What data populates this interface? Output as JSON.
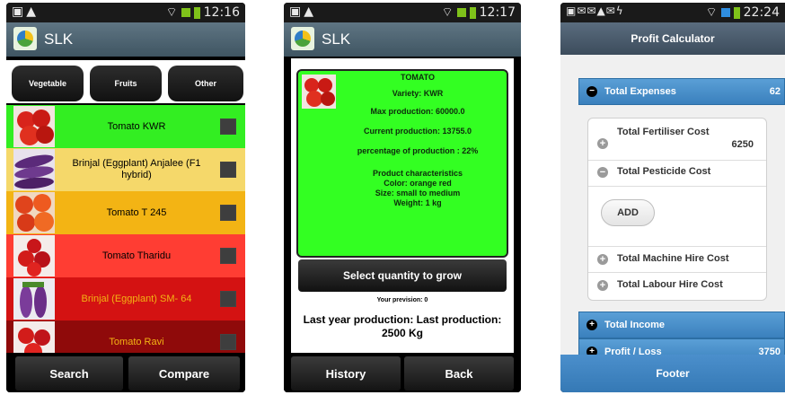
{
  "phone1": {
    "time": "12:16",
    "app_title": "SLK",
    "tabs": [
      "Vegetable",
      "Fruits",
      "Other"
    ],
    "items": [
      {
        "label": "Tomato KWR",
        "bg": "#33ee22"
      },
      {
        "label": "Brinjal (Eggplant) Anjalee (F1 hybrid)",
        "bg": "#f5d86a"
      },
      {
        "label": "Tomato T 245",
        "bg": "#f3b414"
      },
      {
        "label": "Tomato Tharidu",
        "bg": "#ff3d33"
      },
      {
        "label": "Brinjal (Eggplant) SM- 64",
        "bg": "#d41212"
      },
      {
        "label": "Tomato Ravi",
        "bg": "#8f0a0a"
      }
    ],
    "search_label": "Search",
    "compare_label": "Compare"
  },
  "phone2": {
    "time": "12:17",
    "app_title": "SLK",
    "product": {
      "name": "TOMATO",
      "variety": "Variety: KWR",
      "max_production": "Max production: 60000.0",
      "current_production": "Current production: 13755.0",
      "percentage": "percentage of production : 22%",
      "char_title": "Product characteristics",
      "color": "Color: orange red",
      "size": "Size: small to medium",
      "weight": "Weight: 1 kg"
    },
    "select_label": "Select quantity to grow",
    "prevision": "Your prevision: 0",
    "last_year": "Last year production: Last production: 2500 Kg",
    "history_label": "History",
    "back_label": "Back"
  },
  "phone3": {
    "time": "22:24",
    "header_title": "Profit Calculator",
    "total_expenses_label": "Total Expenses",
    "total_expenses_value": "62",
    "fertiliser_label": "Total Fertiliser Cost",
    "fertiliser_value": "6250",
    "pesticide_label": "Total Pesticide Cost",
    "add_label": "ADD",
    "machine_label": "Total Machine Hire Cost",
    "labour_label": "Total Labour Hire Cost",
    "total_income_label": "Total Income",
    "profit_label": "Profit / Loss",
    "profit_value": "3750",
    "footer_label": "Footer"
  }
}
